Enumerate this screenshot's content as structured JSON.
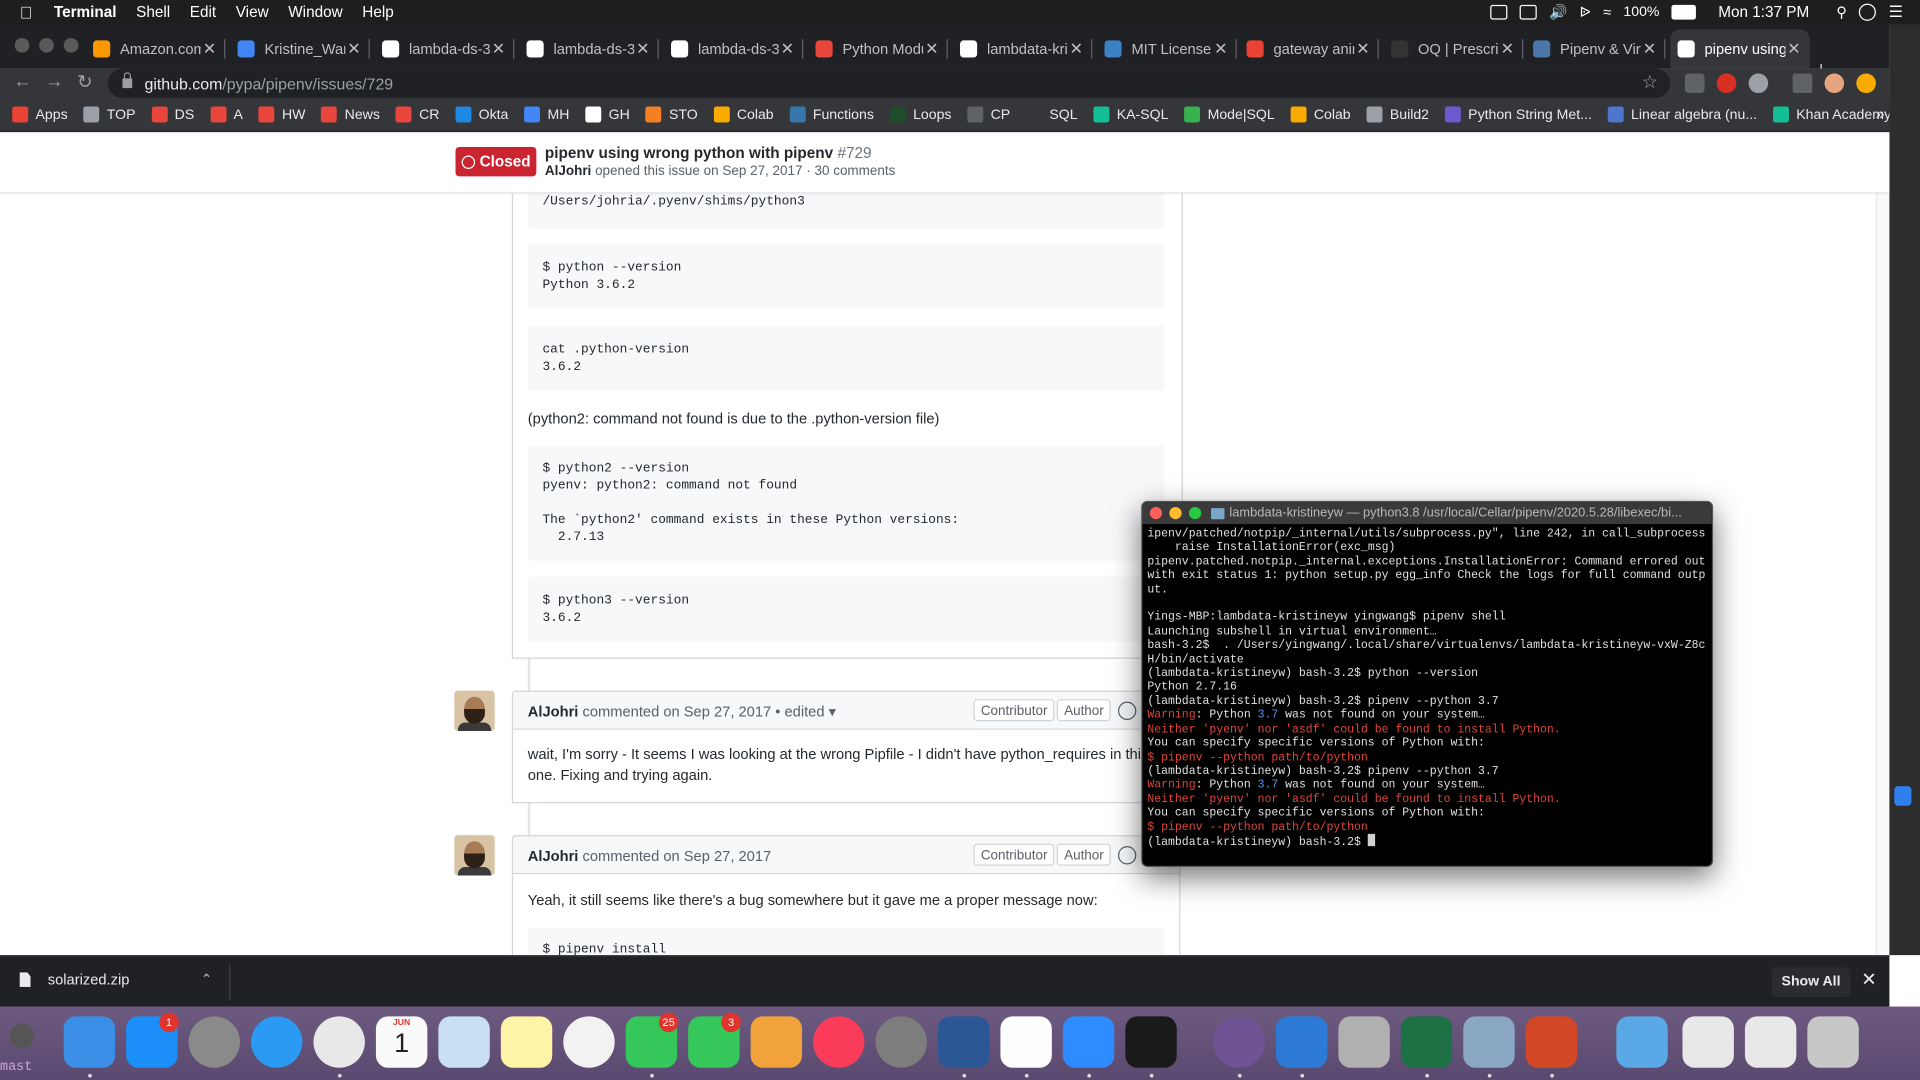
{
  "menubar": {
    "app": "Terminal",
    "items": [
      "Shell",
      "Edit",
      "View",
      "Window",
      "Help"
    ],
    "battery": "100%",
    "clock": "Mon 1:37 PM"
  },
  "tabs": [
    {
      "title": "Amazon.com",
      "color": "#ff9900"
    },
    {
      "title": "Kristine_Wang",
      "color": "#4285f4"
    },
    {
      "title": "lambda-ds-3",
      "color": "#ffffff"
    },
    {
      "title": "lambda-ds-3",
      "color": "#ffffff"
    },
    {
      "title": "lambda-ds-3",
      "color": "#ffffff"
    },
    {
      "title": "Python Modul",
      "color": "#e8453c"
    },
    {
      "title": "lambdata-kris",
      "color": "#ffffff"
    },
    {
      "title": "MIT License",
      "color": "#3b82c4"
    },
    {
      "title": "gateway anim",
      "color": "#ea4335"
    },
    {
      "title": "OQ | Prescrip",
      "color": "#333333"
    },
    {
      "title": "Pipenv & Virtu",
      "color": "#4a76a8"
    },
    {
      "title": "pipenv using w",
      "color": "#ffffff"
    }
  ],
  "url": {
    "host": "github.com",
    "path": "/pypa/pipenv/issues/729"
  },
  "bookmarks": [
    {
      "label": "Apps",
      "color": "#ea4335"
    },
    {
      "label": "TOP",
      "color": "#9aa0a6"
    },
    {
      "label": "DS",
      "color": "#e8453c"
    },
    {
      "label": "A",
      "color": "#e8453c"
    },
    {
      "label": "HW",
      "color": "#e8453c"
    },
    {
      "label": "News",
      "color": "#e8453c"
    },
    {
      "label": "CR",
      "color": "#e8453c"
    },
    {
      "label": "Okta",
      "color": "#1e88e5"
    },
    {
      "label": "MH",
      "color": "#4285f4"
    },
    {
      "label": "GH",
      "color": "#ffffff"
    },
    {
      "label": "STO",
      "color": "#f48024"
    },
    {
      "label": "Colab",
      "color": "#f9ab00"
    },
    {
      "label": "Functions",
      "color": "#3776ab"
    },
    {
      "label": "Loops",
      "color": "#1f4d2b"
    },
    {
      "label": "CP",
      "color": "#5f6368"
    },
    {
      "label": "SQL",
      "color": "#35363a"
    },
    {
      "label": "KA-SQL",
      "color": "#14bf96"
    },
    {
      "label": "Mode|SQL",
      "color": "#37b24d"
    },
    {
      "label": "Colab",
      "color": "#f9ab00"
    },
    {
      "label": "Build2",
      "color": "#9aa0a6"
    },
    {
      "label": "Python String Met...",
      "color": "#6a5acd"
    },
    {
      "label": "Linear algebra (nu...",
      "color": "#4d77cf"
    },
    {
      "label": "Khan Academy | F...",
      "color": "#14bf96"
    }
  ],
  "issue": {
    "status": "Closed",
    "title": "pipenv using wrong python with pipenv",
    "number": "#729",
    "author": "AlJohri",
    "meta": "opened this issue on Sep 27, 2017 · 30 comments"
  },
  "code_blocks": {
    "which": "/Users/johria/.pyenv/shims/python3",
    "b1": [
      "$ python --version",
      "Python 3.6.2"
    ],
    "b2": [
      "cat .python-version",
      "3.6.2"
    ],
    "b3": [
      "$ python2 --version",
      "pyenv: python2: command not found",
      "",
      "The `python2' command exists in these Python versions:",
      "  2.7.13"
    ],
    "b4": [
      "$ python3 --version",
      "3.6.2"
    ],
    "b5": [
      "$ pipenv install"
    ]
  },
  "paragraph_python2": "(python2: command not found is due to the .python-version file)",
  "comments": [
    {
      "author": "AlJohri",
      "action": "commented on Sep 27, 2017 • edited",
      "contributor": "Contributor",
      "role": "Author",
      "body": "wait, I'm sorry - It seems I was looking at the wrong Pipfile - I didn't have python_requires in this one. Fixing and trying again."
    },
    {
      "author": "AlJohri",
      "action": "commented on Sep 27, 2017",
      "contributor": "Contributor",
      "role": "Author",
      "body": "Yeah, it still seems like there's a bug somewhere but it gave me a proper message now:"
    }
  ],
  "terminal": {
    "title": "lambdata-kristineyw — python3.8 /usr/local/Cellar/pipenv/2020.5.28/libexec/bi...",
    "l1": "ipenv/patched/notpip/_internal/utils/subprocess.py\", line 242, in call_subprocess",
    "l2": "    raise InstallationError(exc_msg)",
    "l3": "pipenv.patched.notpip._internal.exceptions.InstallationError: Command errored out with exit status 1: python setup.py egg_info Check the logs for full command output.",
    "l4": "Yings-MBP:lambdata-kristineyw yingwang$ pipenv shell",
    "l5": "Launching subshell in virtual environment…",
    "l6": "bash-3.2$  . /Users/yingwang/.local/share/virtualenvs/lambdata-kristineyw-vxW-Z8cH/bin/activate",
    "l7": "(lambdata-kristineyw) bash-3.2$ python --version",
    "l8": "Python 2.7.16",
    "l9": "(lambdata-kristineyw) bash-3.2$ pipenv --python 3.7",
    "warn_label": "Warning",
    "warn_mid": ": Python ",
    "warn_ver": "3.7",
    "warn_end": " was not found on your system…",
    "neither": "Neither 'pyenv' nor 'asdf' could be found to install Python.",
    "specify": "You can specify specific versions of Python with:",
    "hint": "$ pipenv --python path/to/python",
    "l10": "(lambdata-kristineyw) bash-3.2$ pipenv --python 3.7",
    "prompt": "(lambdata-kristineyw) bash-3.2$ "
  },
  "download": {
    "file": "solarized.zip",
    "show_all": "Show All"
  },
  "dock": {
    "badges": {
      "appstore": "1",
      "messages": "25",
      "facetime": "3"
    },
    "calendar_month": "JUN",
    "calendar_day": "1"
  },
  "branch": "mast"
}
